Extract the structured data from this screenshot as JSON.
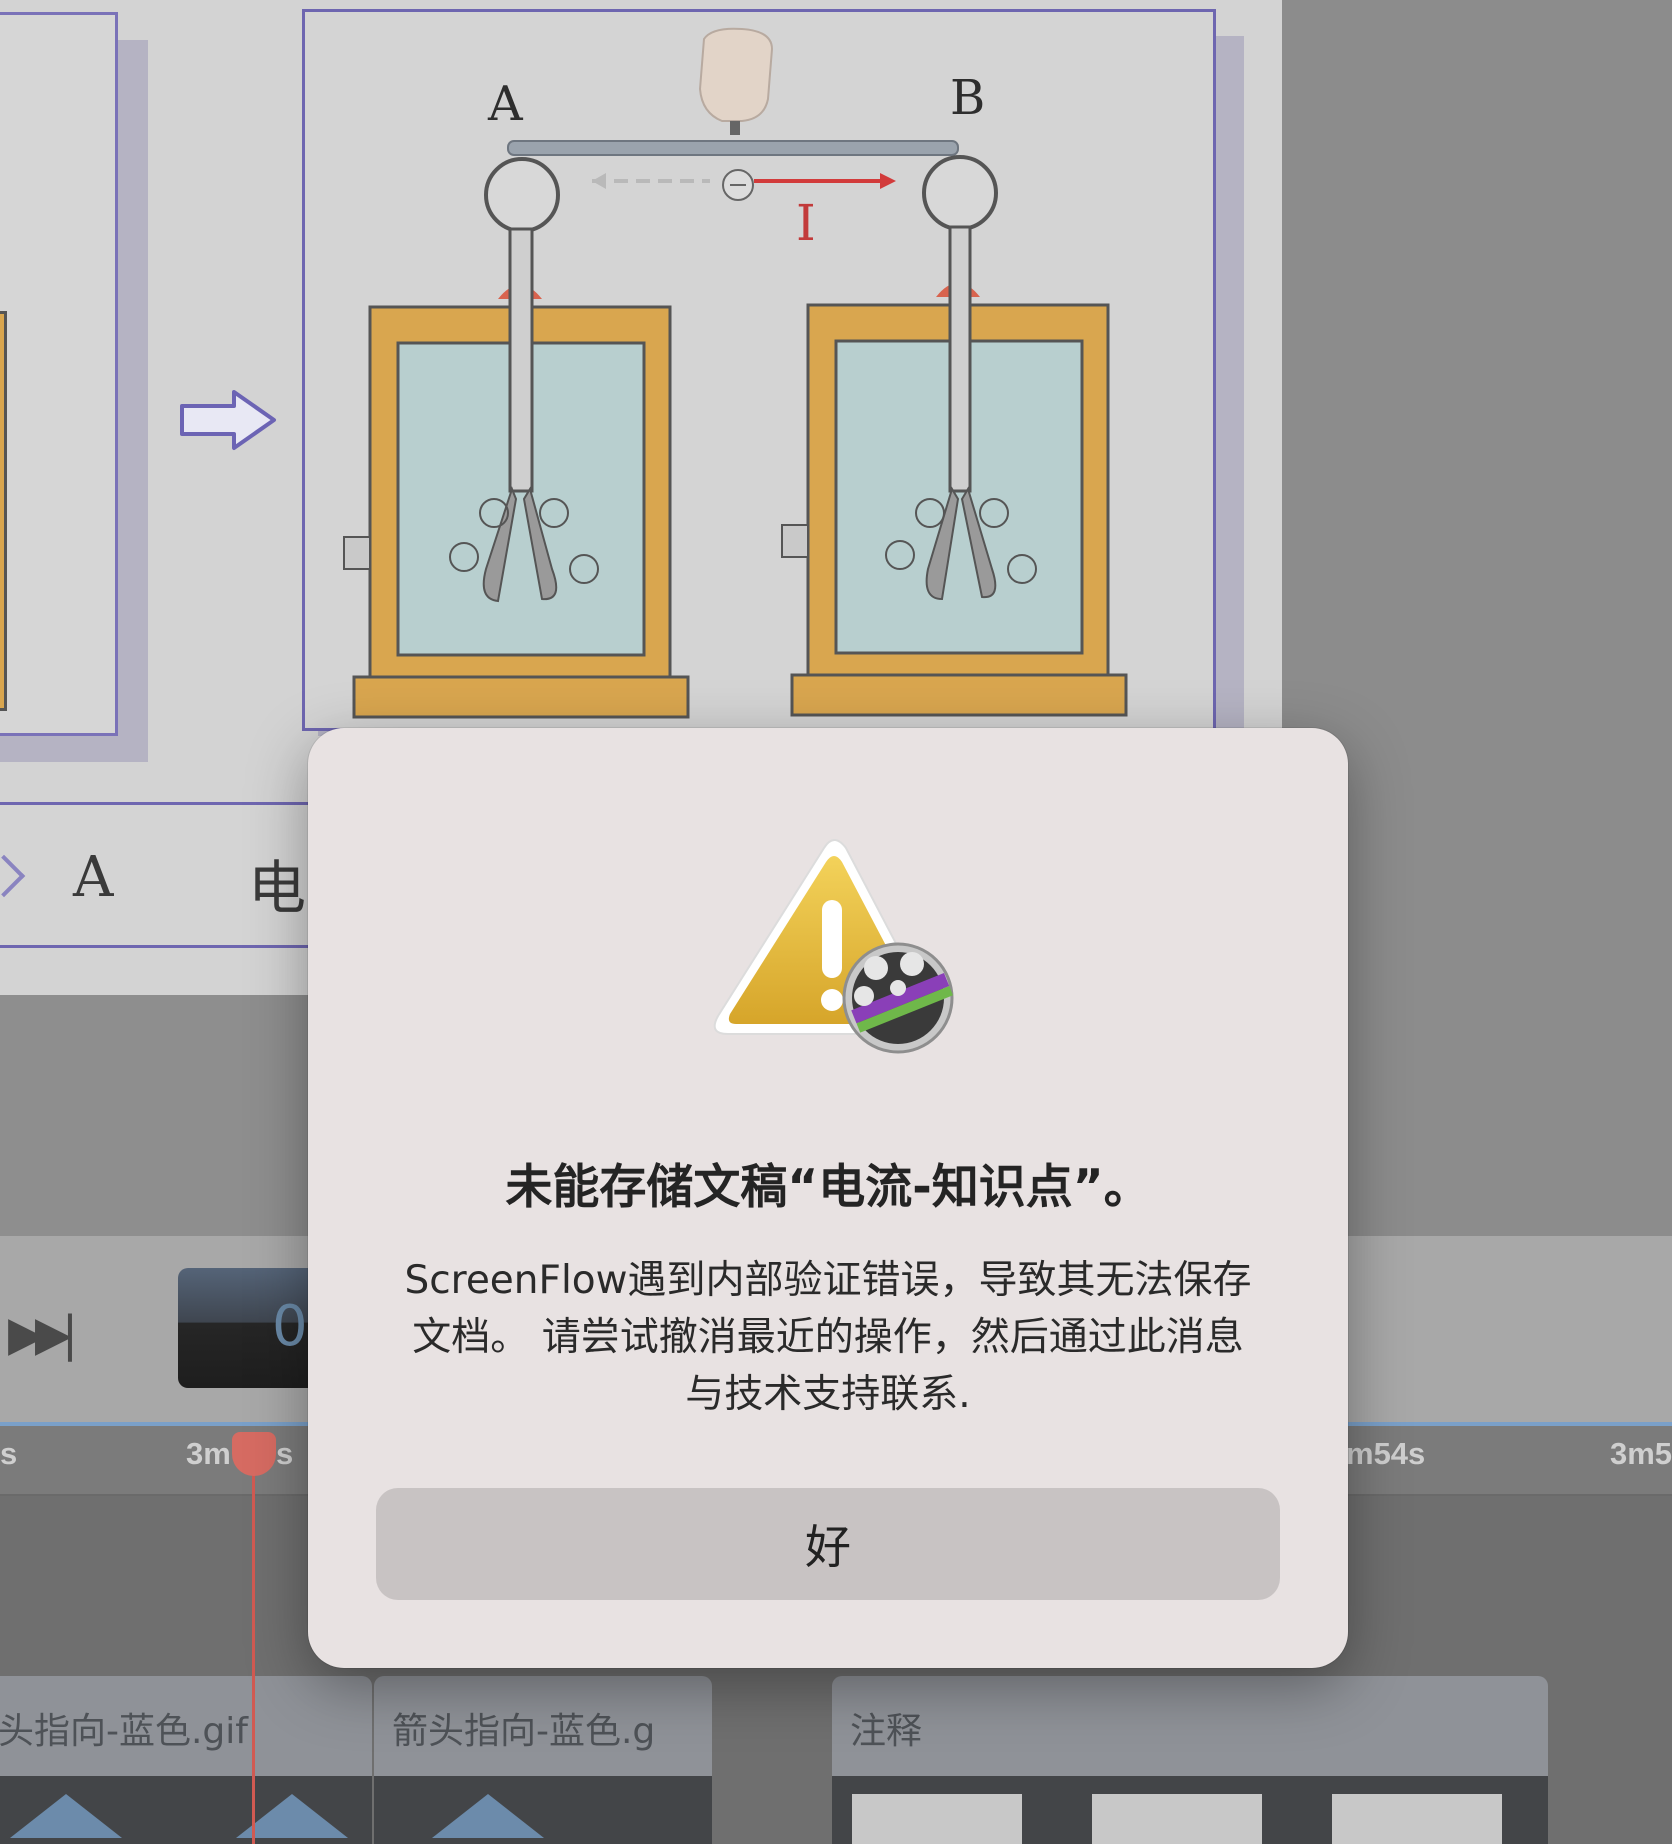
{
  "dialog": {
    "title": "未能存储文稿“电流-知识点”。",
    "message": "ScreenFlow遇到内部验证错误，导致其无法保存文档。 请尝试撤消最近的操作，然后通过此消息与技术支持联系.",
    "ok_button_label": "好",
    "icon": "warning-triangle-with-screenflow-badge"
  },
  "slide": {
    "label_a": "A",
    "label_b": "B",
    "current_label": "I"
  },
  "caption_strip": {
    "letter": "A",
    "hanzi": "电"
  },
  "transport": {
    "fast_forward_label": "▶▶|",
    "timecode_partial": "0"
  },
  "ruler": {
    "tick_left": "s",
    "tick_playhead": "3m",
    "tick_playhead_suffix": "s",
    "tick_right": "m54s",
    "tick_far_right": "3m5"
  },
  "clips": [
    {
      "label": "头指向-蓝色.gif"
    },
    {
      "label": "箭头指向-蓝色.g"
    },
    {
      "label": "注释"
    }
  ],
  "colors": {
    "dialog_bg": "#e8e2e2",
    "ok_button_bg": "#c8c3c3",
    "playhead": "#d15a52",
    "current_arrow": "#d23b3b"
  }
}
